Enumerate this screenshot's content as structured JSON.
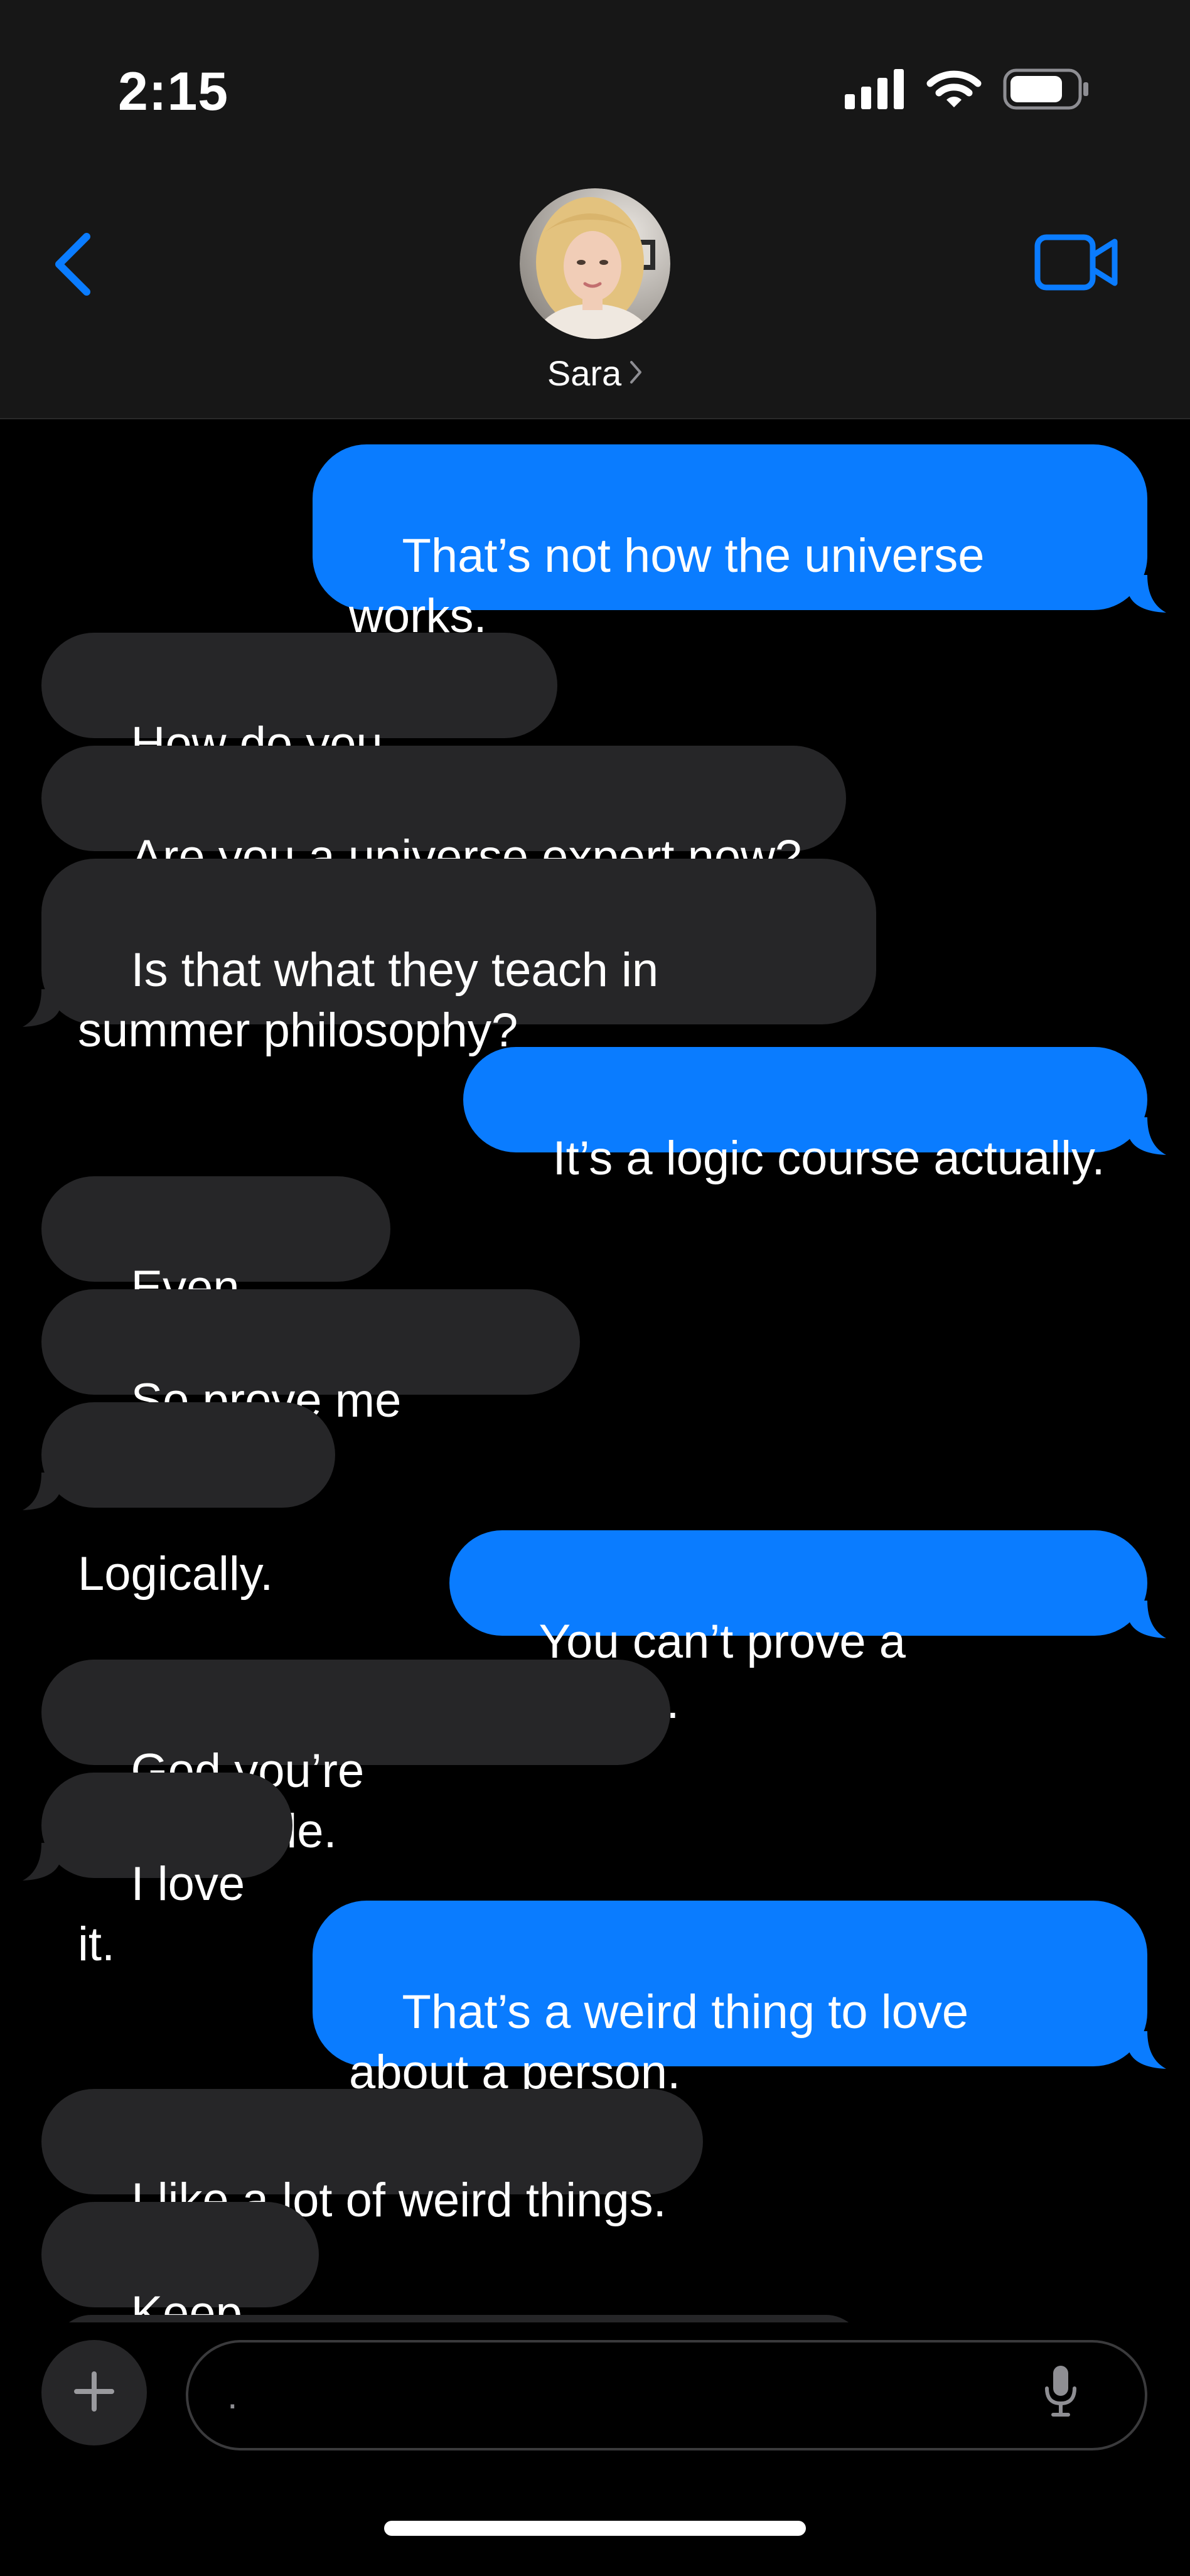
{
  "status_bar": {
    "time": "2:15"
  },
  "header": {
    "contact_name": "Sara",
    "chevron": "›"
  },
  "messages": [
    {
      "from": "me",
      "text": "That’s not how the universe\nworks."
    },
    {
      "from": "them",
      "text": "How do you know?"
    },
    {
      "from": "them",
      "text": "Are you a universe expert now?"
    },
    {
      "from": "them",
      "text": "Is that what they teach in\nsummer philosophy?"
    },
    {
      "from": "me",
      "text": "It’s a logic course actually."
    },
    {
      "from": "them",
      "text": "Even better."
    },
    {
      "from": "them",
      "text": "So prove me wrong."
    },
    {
      "from": "them",
      "text": "Logically."
    },
    {
      "from": "me",
      "text": "You can’t prove a negative."
    },
    {
      "from": "them",
      "text": "God you’re insufferable."
    },
    {
      "from": "them",
      "text": "I love it."
    },
    {
      "from": "me",
      "text": "That’s a weird thing to love\nabout a person."
    },
    {
      "from": "them",
      "text": "I like a lot of weird things."
    },
    {
      "from": "them",
      "text": "Keep up."
    }
  ],
  "input": {
    "value": ".",
    "placeholder": ""
  },
  "colors": {
    "sent_bubble": "#0a7cff",
    "received_bubble": "#262628",
    "accent": "#0a7cff",
    "header_bg": "#171717",
    "background": "#000000"
  },
  "icons": {
    "back": "chevron-left-icon",
    "video": "video-camera-icon",
    "plus": "plus-icon",
    "mic": "microphone-icon",
    "signal": "cellular-signal-icon",
    "wifi": "wifi-icon",
    "battery": "battery-icon"
  }
}
